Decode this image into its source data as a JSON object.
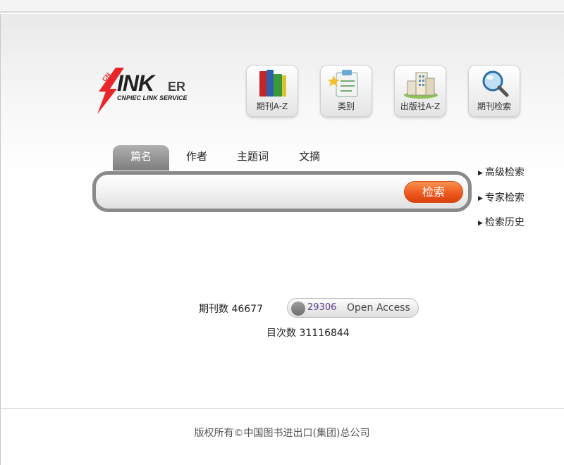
{
  "logo": {
    "main": "INK",
    "suffix": "ER",
    "tagline": "CNPIEC LINK SERVICE",
    "badge": "CN"
  },
  "nav": [
    {
      "label": "期刊A-Z",
      "icon": "books-icon"
    },
    {
      "label": "类别",
      "icon": "clipboard-icon"
    },
    {
      "label": "出版社A-Z",
      "icon": "buildings-icon"
    },
    {
      "label": "期刊检索",
      "icon": "magnifier-icon"
    }
  ],
  "tabs": [
    "篇名",
    "作者",
    "主题词",
    "文摘"
  ],
  "search": {
    "value": "",
    "button": "检索"
  },
  "side_links": [
    "高级检索",
    "专家检索",
    "检索历史"
  ],
  "stats": {
    "journals_label": "期刊数 46677",
    "oa_count": "29306",
    "oa_label": "Open Access",
    "toc_label": "目次数 31116844"
  },
  "footer": "版权所有©中国图书进出口(集团)总公司",
  "colors": {
    "accent": "#ef5a1f",
    "tab_active": "#8a8a8a",
    "oa_number": "#5a3c8c"
  }
}
